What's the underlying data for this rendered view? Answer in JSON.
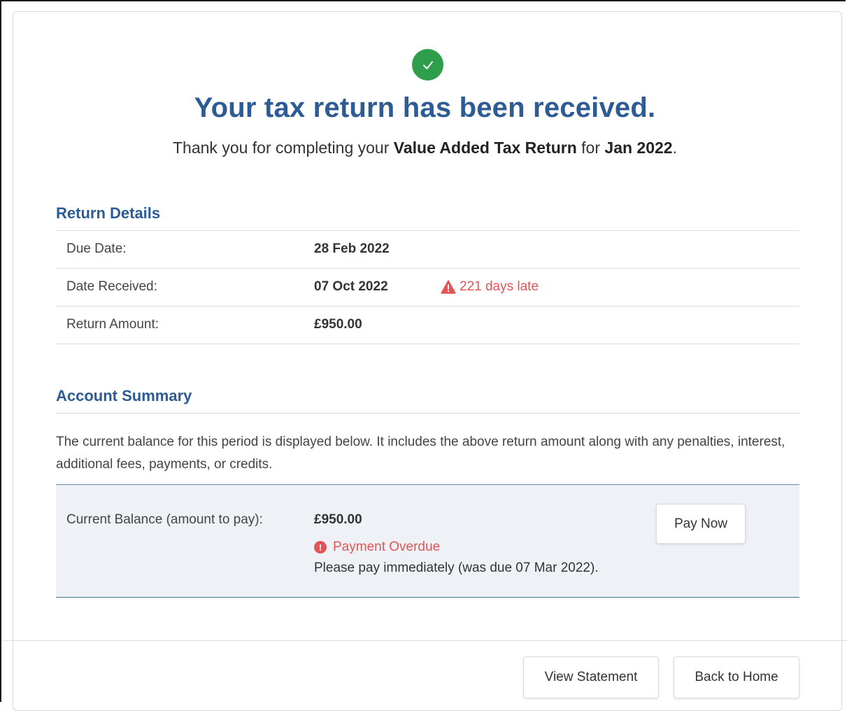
{
  "header": {
    "title": "Your tax return has been received.",
    "subtitle_prefix": "Thank you for completing your ",
    "return_type": "Value Added Tax Return",
    "subtitle_middle": " for ",
    "period": "Jan 2022",
    "subtitle_suffix": ".",
    "icon": "check-circle-icon",
    "icon_color": "#2e9e4a"
  },
  "return_details": {
    "title": "Return Details",
    "rows": [
      {
        "label": "Due Date:",
        "value": "28 Feb 2022"
      },
      {
        "label": "Date Received:",
        "value": "07 Oct 2022"
      },
      {
        "label": "Return Amount:",
        "value": "£950.00"
      }
    ],
    "late_notice": "221 days late",
    "late_icon": "warning-triangle-icon",
    "alert_color": "#e05555"
  },
  "account_summary": {
    "title": "Account Summary",
    "description": "The current balance for this period is displayed below. It includes the above return amount along with any penalties, interest, additional fees, payments, or credits.",
    "balance_label": "Current Balance (amount to pay):",
    "balance_value": "£950.00",
    "overdue_label": "Payment Overdue",
    "overdue_icon": "exclamation-circle-icon",
    "pay_note": "Please pay immediately (was due 07 Mar 2022).",
    "pay_button": "Pay Now"
  },
  "footer": {
    "view_statement": "View Statement",
    "back_home": "Back to Home"
  },
  "colors": {
    "heading_blue": "#2d5b94",
    "success_green": "#2e9e4a",
    "alert_red": "#e05555",
    "balance_bg": "#eef2f6"
  }
}
